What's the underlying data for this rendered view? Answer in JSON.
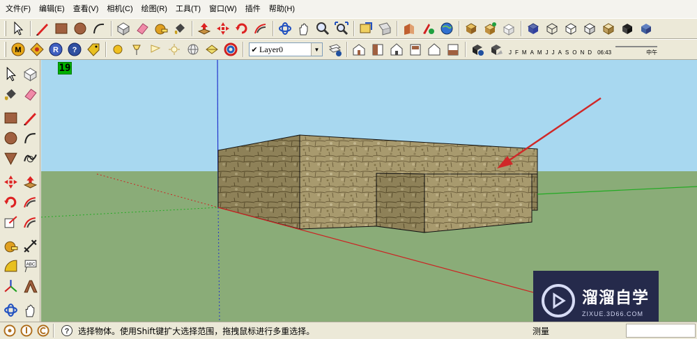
{
  "menu": [
    "文件(F)",
    "编辑(E)",
    "查看(V)",
    "相机(C)",
    "绘图(R)",
    "工具(T)",
    "窗口(W)",
    "插件",
    "帮助(H)"
  ],
  "layer": {
    "current": "Layer0",
    "check": "✔"
  },
  "shadow": {
    "months": [
      "J",
      "F",
      "M",
      "A",
      "M",
      "J",
      "J",
      "A",
      "S",
      "O",
      "N",
      "D"
    ],
    "time": "06:43",
    "noon_label": "中午"
  },
  "viewport": {
    "fps": "19",
    "sky_color": "#a8d8f0",
    "ground_color": "#8aac78",
    "axis_red": "#cc2222",
    "axis_green": "#22aa22",
    "axis_blue": "#2233cc",
    "arrow_color": "#d02828",
    "stone_color": "#a89a6e"
  },
  "watermark": {
    "brand": "溜溜自学",
    "url": "ZIXUE.3D66.COM"
  },
  "status": {
    "message": "选择物体。使用Shift键扩大选择范围，拖拽鼠标进行多重选择。",
    "measure_label": "测量",
    "measure_value": ""
  }
}
